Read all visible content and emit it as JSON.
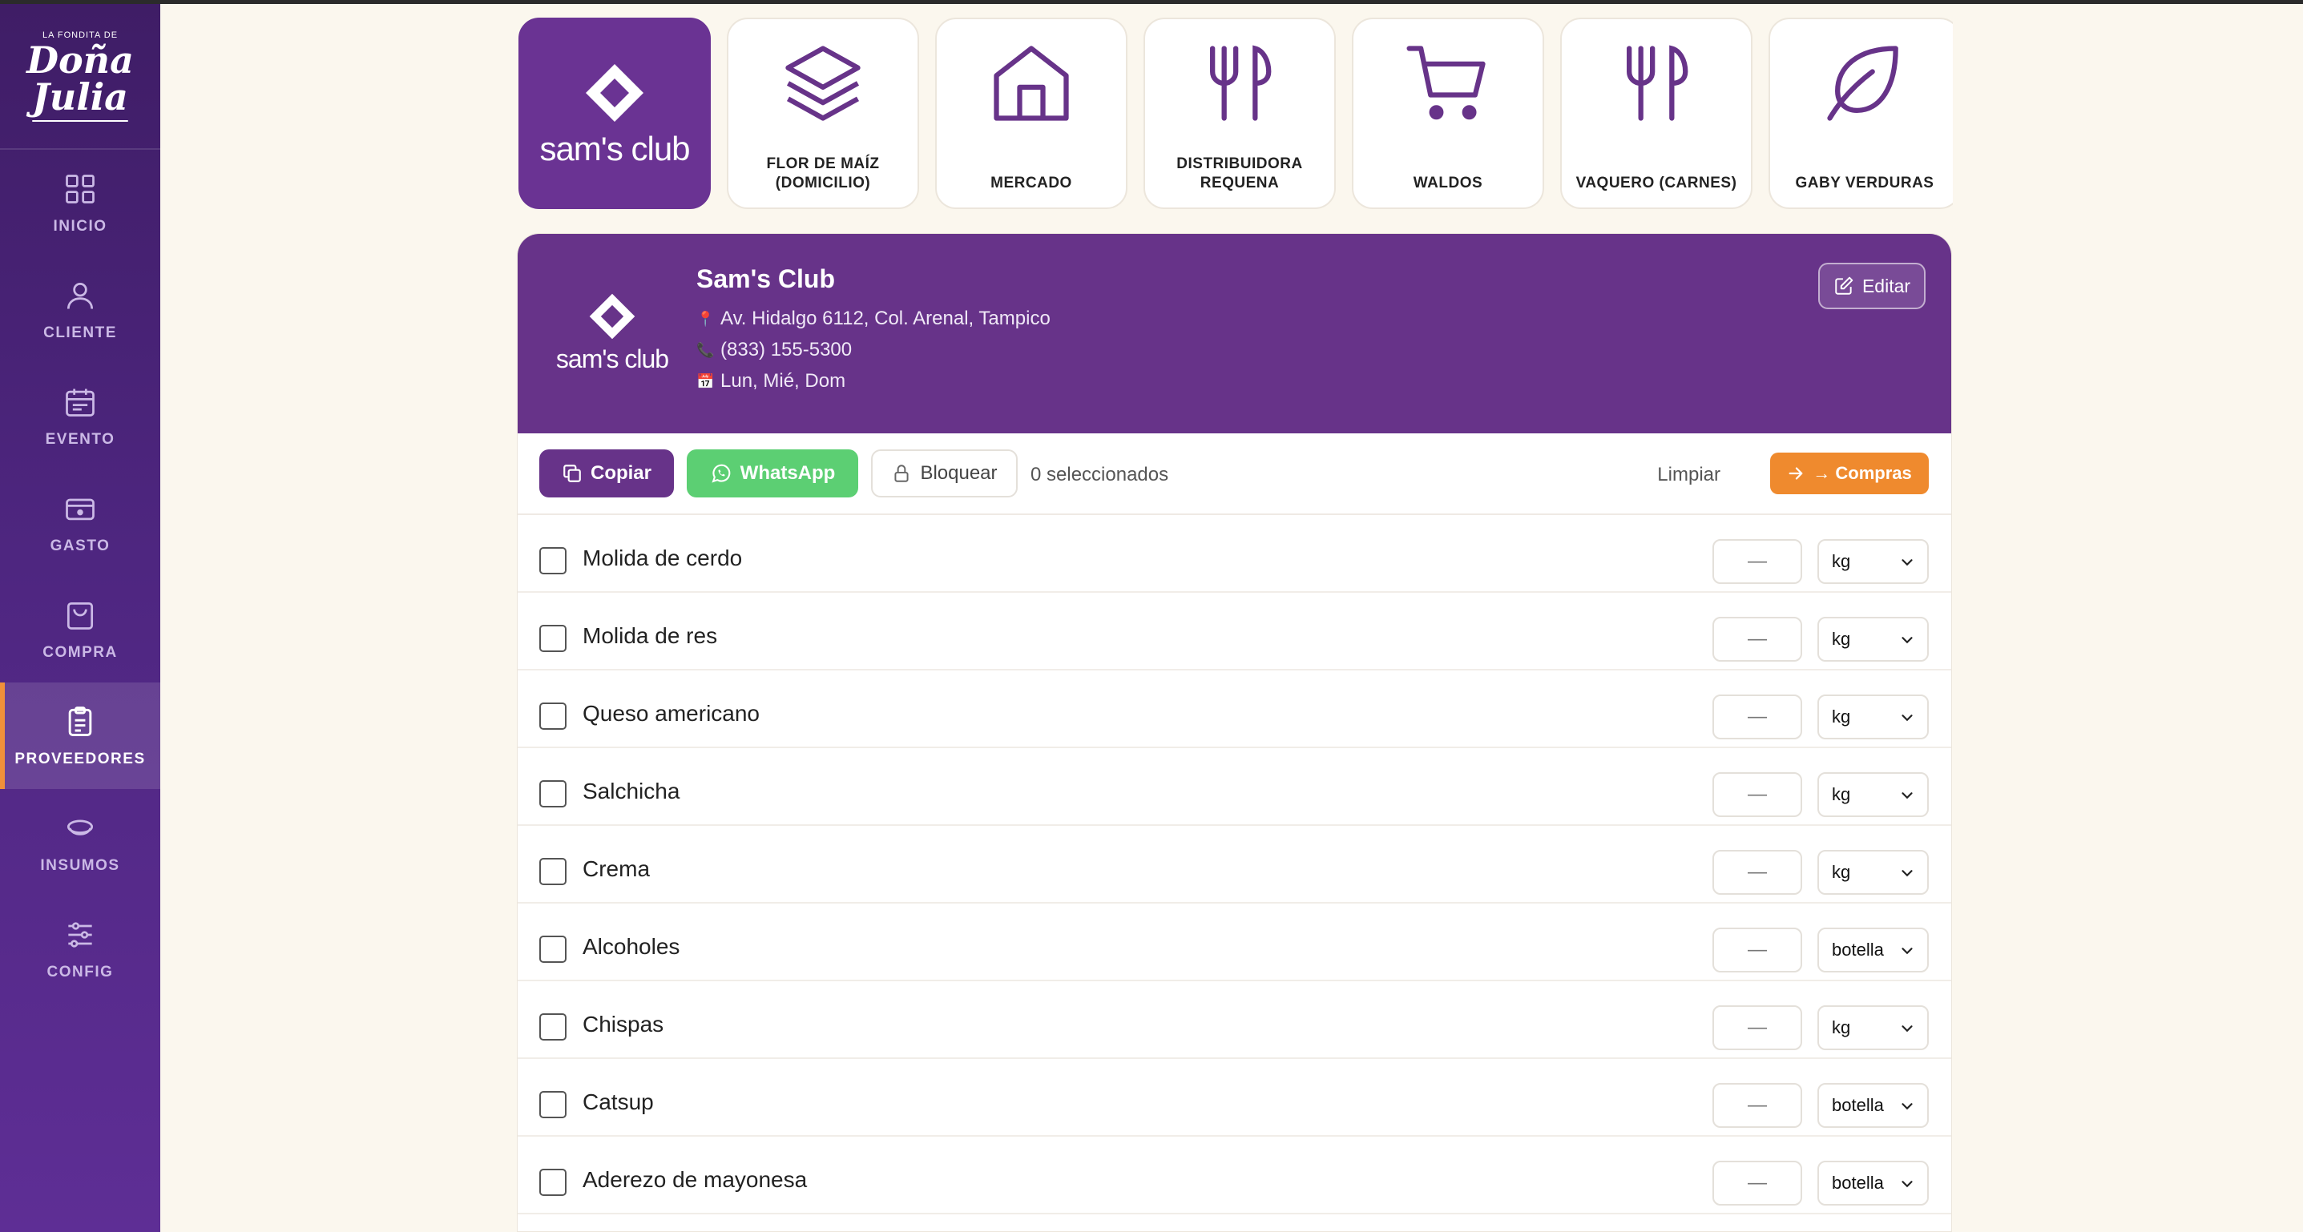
{
  "brand": {
    "small": "LA FONDITA DE",
    "name_line1": "Doña",
    "name_line2": "Julia"
  },
  "nav": [
    {
      "label": "INICIO",
      "icon": "grid-icon",
      "active": false
    },
    {
      "label": "CLIENTE",
      "icon": "user-icon",
      "active": false
    },
    {
      "label": "EVENTO",
      "icon": "calendar-icon",
      "active": false
    },
    {
      "label": "GASTO",
      "icon": "wallet-icon",
      "active": false
    },
    {
      "label": "COMPRA",
      "icon": "shopping-bag-icon",
      "active": false
    },
    {
      "label": "PROVEEDORES",
      "icon": "clipboard-icon",
      "active": true
    },
    {
      "label": "INSUMOS",
      "icon": "bowl-icon",
      "active": false
    },
    {
      "label": "CONFIG",
      "icon": "sliders-icon",
      "active": false
    }
  ],
  "suppliers": [
    {
      "name": "sam's club",
      "icon": "sams-club-logo",
      "active": true
    },
    {
      "name": "FLOR DE MAÍZ (DOMICILIO)",
      "icon": "layers-icon",
      "active": false
    },
    {
      "name": "MERCADO",
      "icon": "house-icon",
      "active": false
    },
    {
      "name": "DISTRIBUIDORA REQUENA",
      "icon": "utensils-icon",
      "active": false
    },
    {
      "name": "WALDOS",
      "icon": "cart-icon",
      "active": false
    },
    {
      "name": "VAQUERO (CARNES)",
      "icon": "utensils-icon",
      "active": false
    },
    {
      "name": "GABY VERDURAS",
      "icon": "leaf-icon",
      "active": false
    }
  ],
  "detail": {
    "logo_text": "sam's club",
    "title": "Sam's Club",
    "address": "Av. Hidalgo 6112, Col. Arenal, Tampico",
    "phone": "(833) 155-5300",
    "days": "Lun, Mié, Dom",
    "edit_label": "Editar"
  },
  "toolbar": {
    "copy_label": "Copiar",
    "whatsapp_label": "WhatsApp",
    "block_label": "Bloquear",
    "selected_count": "0 seleccionados",
    "clear_label": "Limpiar",
    "compras_label": "→ Compras"
  },
  "items": [
    {
      "name": "Molida de cerdo",
      "qty": "—",
      "unit": "kg"
    },
    {
      "name": "Molida de res",
      "qty": "—",
      "unit": "kg"
    },
    {
      "name": "Queso americano",
      "qty": "—",
      "unit": "kg"
    },
    {
      "name": "Salchicha",
      "qty": "—",
      "unit": "kg"
    },
    {
      "name": "Crema",
      "qty": "—",
      "unit": "kg"
    },
    {
      "name": "Alcoholes",
      "qty": "—",
      "unit": "botella"
    },
    {
      "name": "Chispas",
      "qty": "—",
      "unit": "kg"
    },
    {
      "name": "Catsup",
      "qty": "—",
      "unit": "botella"
    },
    {
      "name": "Aderezo de mayonesa",
      "qty": "—",
      "unit": "botella"
    }
  ],
  "colors": {
    "primary": "#673389",
    "accent": "#ef8a2e",
    "whatsapp": "#5ccf73",
    "background": "#fbf7ee"
  }
}
